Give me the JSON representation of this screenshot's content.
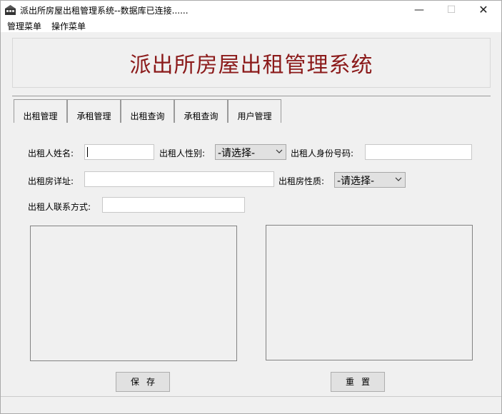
{
  "window": {
    "title": "派出所房屋出租管理系统--数据库已连接......",
    "controls": {
      "minimize": "—",
      "maximize": "☐",
      "close": "✕"
    }
  },
  "menubar": {
    "items": [
      {
        "label": "管理菜单"
      },
      {
        "label": "操作菜单"
      }
    ]
  },
  "header": {
    "title": "派出所房屋出租管理系统"
  },
  "tabs": [
    {
      "label": "出租管理"
    },
    {
      "label": "承租管理"
    },
    {
      "label": "出租查询"
    },
    {
      "label": "承租查询"
    },
    {
      "label": "用户管理"
    }
  ],
  "form": {
    "landlord_name_label": "出租人姓名:",
    "landlord_name_value": "",
    "landlord_gender_label": "出租人性别:",
    "landlord_gender_value": "-请选择-",
    "landlord_id_label": "出租人身份号码:",
    "landlord_id_value": "",
    "house_address_label": "出租房详址:",
    "house_address_value": "",
    "house_type_label": "出租房性质:",
    "house_type_value": "-请选择-",
    "landlord_contact_label": "出租人联系方式:",
    "landlord_contact_value": ""
  },
  "buttons": {
    "save": "保存",
    "reset": "重置"
  }
}
